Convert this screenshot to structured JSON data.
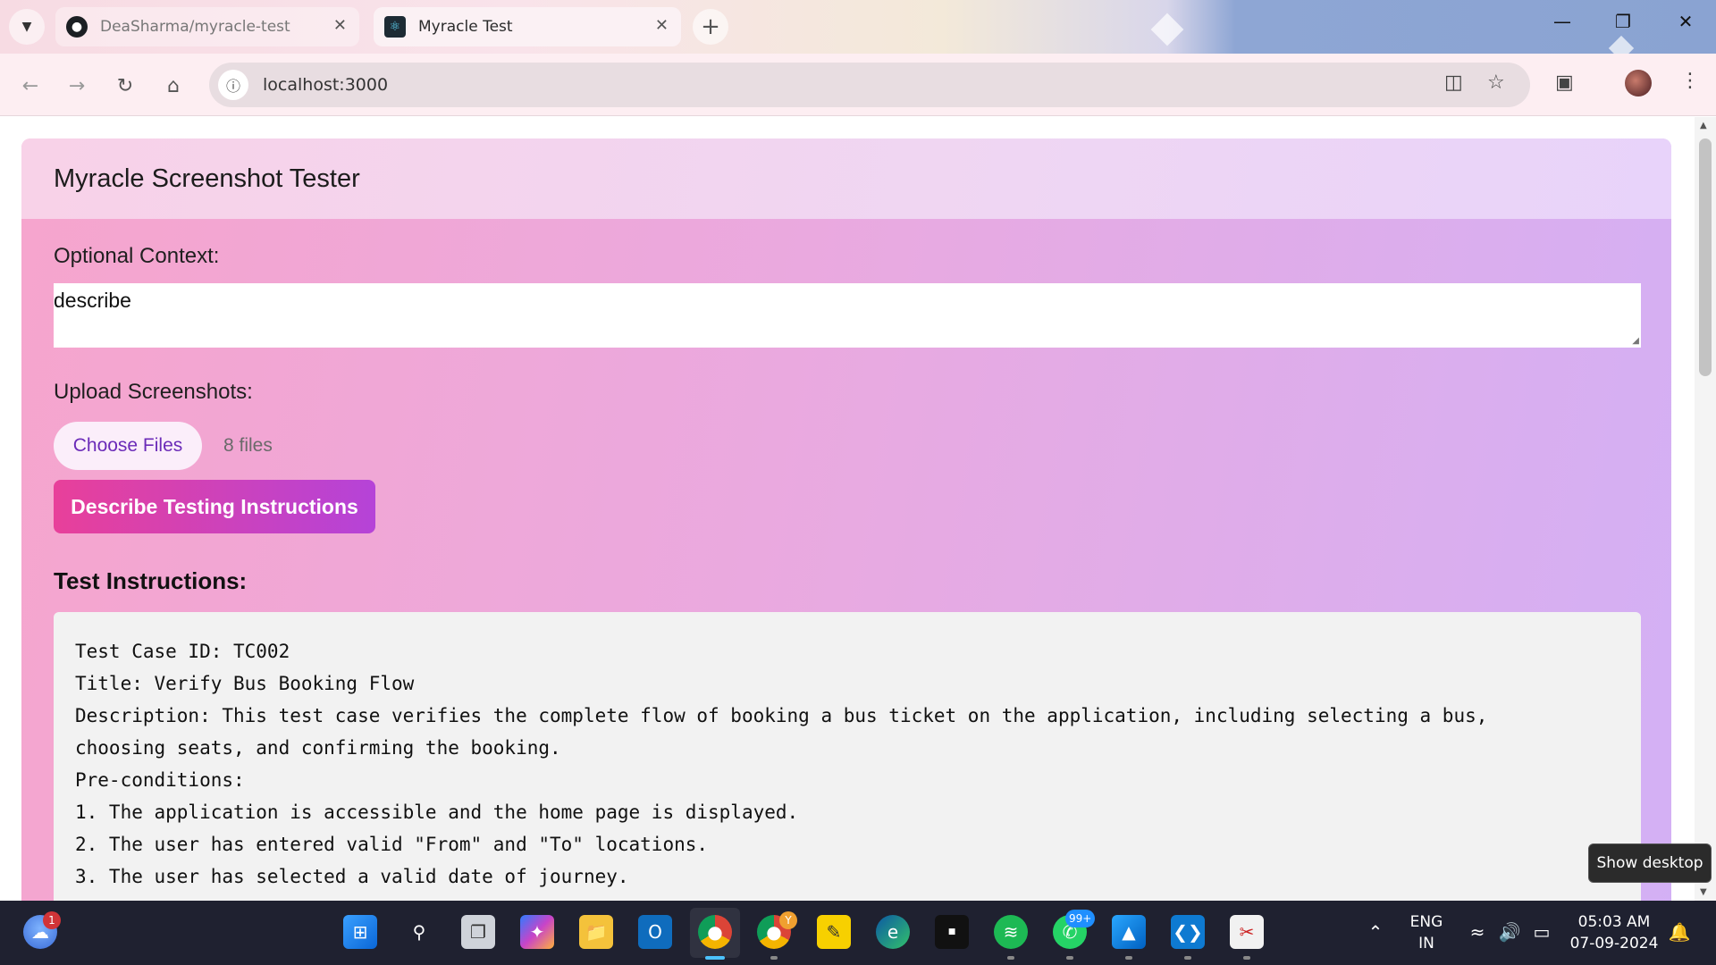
{
  "browser": {
    "tabs": [
      {
        "title": "DeaSharma/myracle-test",
        "favicon": "github-icon",
        "active": false
      },
      {
        "title": "Myracle Test",
        "favicon": "react-icon",
        "active": true
      }
    ],
    "url": "localhost:3000"
  },
  "page": {
    "header_title": "Myracle Screenshot Tester",
    "context_label": "Optional Context:",
    "context_value": "describe",
    "upload_label": "Upload Screenshots:",
    "choose_files_label": "Choose Files",
    "files_count": "8 files",
    "describe_button_label": "Describe Testing Instructions",
    "instructions_title": "Test Instructions:",
    "instructions_lines": [
      "Test Case ID: TC002",
      "Title: Verify Bus Booking Flow",
      "Description: This test case verifies the complete flow of booking a bus ticket on the application, including selecting a bus,",
      "choosing seats, and confirming the booking.",
      "Pre-conditions:",
      "1. The application is accessible and the home page is displayed.",
      "2. The user has entered valid \"From\" and \"To\" locations.",
      "3. The user has selected a valid date of journey."
    ]
  },
  "tooltip": "Show desktop",
  "taskbar": {
    "weather_badge": "1",
    "whatsapp_badge": "99+",
    "chrome_profile_badge": "Y",
    "language": "ENG",
    "region": "IN",
    "time": "05:03 AM",
    "date": "07-09-2024"
  },
  "colors": {
    "accent_gradient_start": "#e8409a",
    "accent_gradient_end": "#b543d8",
    "choose_files_text": "#6b2bb8"
  }
}
